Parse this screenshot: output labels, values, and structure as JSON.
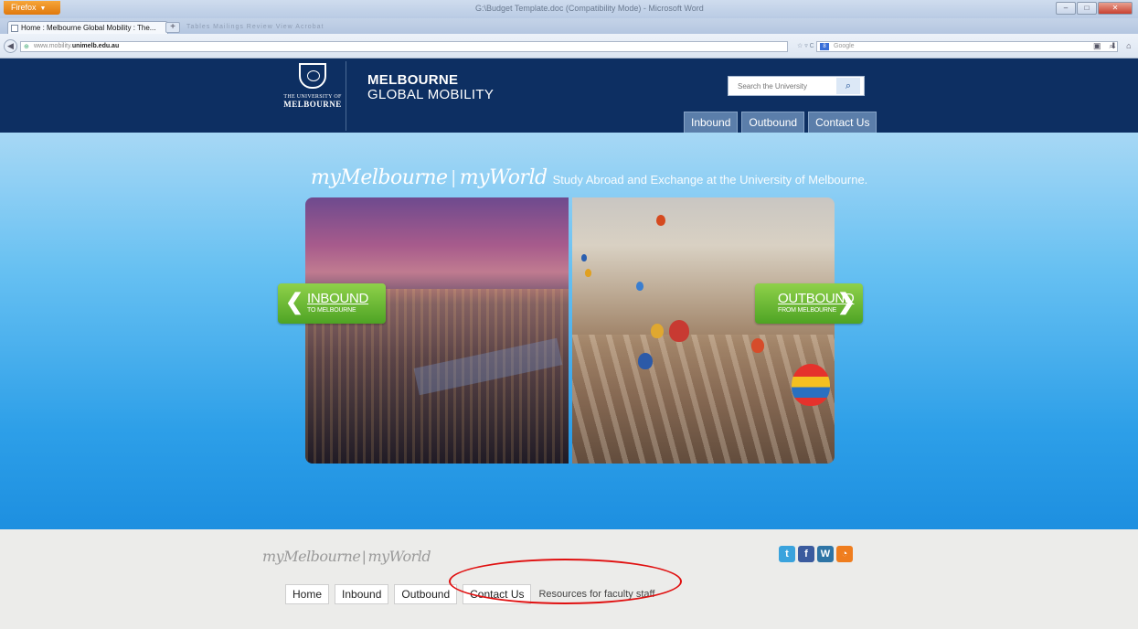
{
  "browser": {
    "app_button": "Firefox",
    "window_title": "G:\\Budget Template.doc (Compatibility Mode) - Microsoft Word",
    "tab_title": "Home : Melbourne Global Mobility : The...",
    "new_tab": "+",
    "ghost_tabs": "Tables   Mailings   Review   View   Acrobat",
    "url_prefix": "www.mobility.",
    "url_domain": "unimelb.edu.au",
    "search_engine": "8",
    "search_placeholder": "Google"
  },
  "header": {
    "crest_small": "THE UNIVERSITY OF",
    "crest_big": "MELBOURNE",
    "brand_line1": "MELBOURNE",
    "brand_line2": "GLOBAL MOBILITY",
    "search_placeholder": "Search the University",
    "nav": [
      "Inbound",
      "Outbound",
      "Contact Us"
    ]
  },
  "hero": {
    "tagline_script1": "myMelbourne",
    "tagline_separator": "|",
    "tagline_script2": "myWorld",
    "tagline_text": "Study Abroad and Exchange at the University of Melbourne.",
    "inbound_title": "INBOUND",
    "inbound_sub": "TO MELBOURNE",
    "outbound_title": "OUTBOUND",
    "outbound_sub": "FROM MELBOURNE"
  },
  "footer": {
    "logo_script1": "myMelbourne",
    "logo_separator": "|",
    "logo_script2": "myWorld",
    "social": [
      "t",
      "f",
      "W",
      "◔"
    ],
    "nav": [
      "Home",
      "Inbound",
      "Outbound",
      "Contact Us"
    ],
    "extra_link": "Resources for faculty staff"
  },
  "colors": {
    "header_bg": "#0d2f62",
    "hero_top": "#a7d8f5",
    "hero_bottom": "#1d8fe0",
    "cta_green": "#4ea324",
    "annotation_red": "#e01010"
  }
}
